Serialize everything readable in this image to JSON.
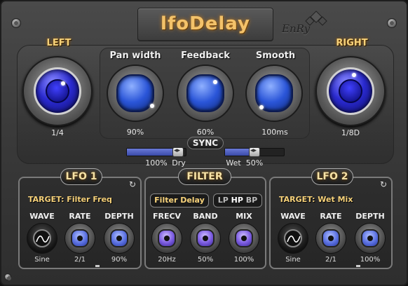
{
  "title": "lfoDelay",
  "brand": "EnRy",
  "left": {
    "label": "LEFT",
    "value": "1/4"
  },
  "right": {
    "label": "RIGHT",
    "value": "1/8D"
  },
  "pan_width": {
    "label": "Pan width",
    "value": "90%"
  },
  "feedback": {
    "label": "Feedback",
    "value": "60%"
  },
  "smooth": {
    "label": "Smooth",
    "value": "100ms"
  },
  "sync_label": "SYNC",
  "dry": {
    "value": "100%",
    "label": "Dry",
    "level": 0.95
  },
  "wet": {
    "value": "50%",
    "label": "Wet",
    "level": 0.5
  },
  "lfo1": {
    "title": "LFO 1",
    "target": "TARGET: Filter Freq",
    "wave": {
      "label": "WAVE",
      "value": "Sine"
    },
    "rate": {
      "label": "RATE",
      "value": "2/1"
    },
    "depth": {
      "label": "DEPTH",
      "value": "90%"
    }
  },
  "filter": {
    "title": "FILTER",
    "mode_button": "Filter Delay",
    "type_lp": "LP",
    "type_hp": "HP",
    "type_bp": "BP",
    "frecv": {
      "label": "FRECV",
      "value": "20Hz"
    },
    "band": {
      "label": "BAND",
      "value": "50%"
    },
    "mix": {
      "label": "MIX",
      "value": "100%"
    }
  },
  "lfo2": {
    "title": "LFO 2",
    "target": "TARGET: Wet Mix",
    "wave": {
      "label": "WAVE",
      "value": "Sine"
    },
    "rate": {
      "label": "RATE",
      "value": "2/1"
    },
    "depth": {
      "label": "DEPTH",
      "value": "100%"
    }
  },
  "icons": {
    "reset": "reset-icon",
    "wave": "sine-wave-icon"
  },
  "colors": {
    "accent_gold": "#f7d27a",
    "knob_blue": "#2a55d8",
    "knob_violet": "#7a5ae0",
    "slider_fill": "#4a5ac0"
  }
}
